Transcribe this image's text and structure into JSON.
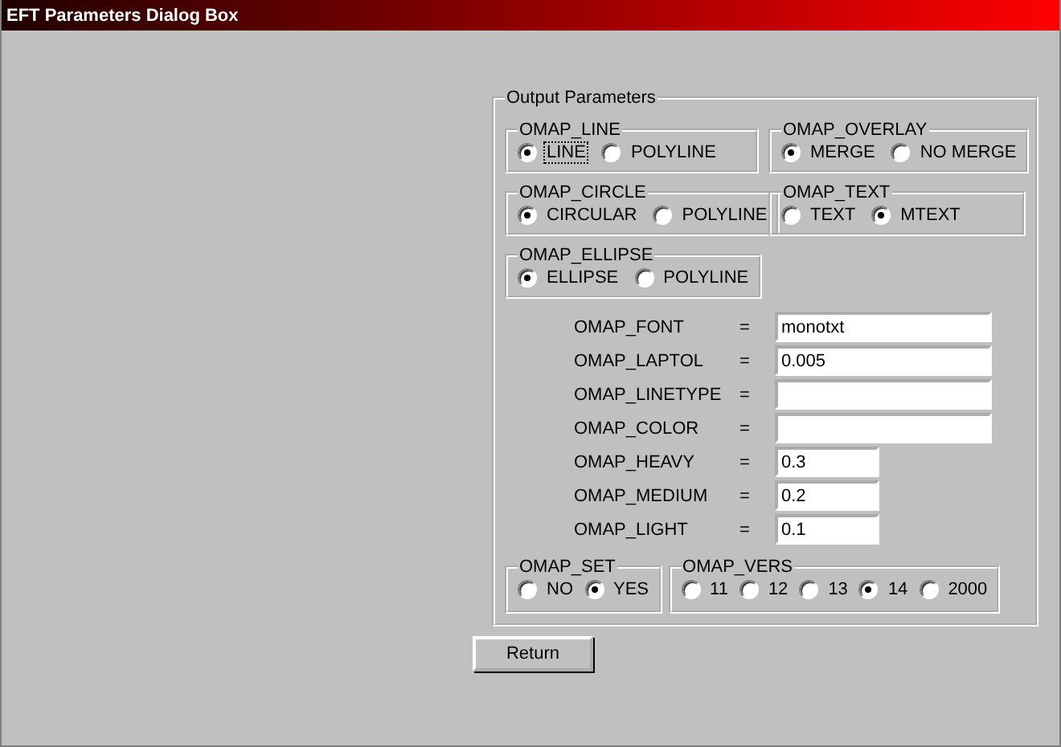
{
  "window": {
    "title": "EFT Parameters Dialog Box"
  },
  "output_parameters": {
    "title": "Output Parameters",
    "groups": [
      {
        "title": "OMAP_LINE",
        "options": [
          {
            "label": "LINE",
            "selected": true,
            "focused": true
          },
          {
            "label": "POLYLINE",
            "selected": false,
            "focused": false
          }
        ]
      },
      {
        "title": "OMAP_OVERLAY",
        "options": [
          {
            "label": "MERGE",
            "selected": true,
            "focused": false
          },
          {
            "label": "NO MERGE",
            "selected": false,
            "focused": false
          }
        ]
      },
      {
        "title": "OMAP_CIRCLE",
        "options": [
          {
            "label": "CIRCULAR",
            "selected": true,
            "focused": false
          },
          {
            "label": "POLYLINE",
            "selected": false,
            "focused": false
          }
        ]
      },
      {
        "title": "OMAP_TEXT",
        "options": [
          {
            "label": "TEXT",
            "selected": false,
            "focused": false
          },
          {
            "label": "MTEXT",
            "selected": true,
            "focused": false
          }
        ]
      },
      {
        "title": "OMAP_ELLIPSE",
        "options": [
          {
            "label": "ELLIPSE",
            "selected": true,
            "focused": false
          },
          {
            "label": "POLYLINE",
            "selected": false,
            "focused": false
          }
        ]
      }
    ],
    "fields": [
      {
        "label": "OMAP_FONT",
        "equals": "=",
        "value": "monotxt",
        "kind": "long"
      },
      {
        "label": "OMAP_LAPTOL",
        "equals": "=",
        "value": "0.005",
        "kind": "long"
      },
      {
        "label": "OMAP_LINETYPE",
        "equals": "=",
        "kind": "long"
      },
      {
        "label": "OMAP_COLOR",
        "equals": "=",
        "kind": "long"
      },
      {
        "label": "OMAP_HEAVY",
        "equals": "=",
        "value": "0.3",
        "kind": "short"
      },
      {
        "label": "OMAP_MEDIUM",
        "equals": "=",
        "value": "0.2",
        "kind": "short"
      },
      {
        "label": "OMAP_LIGHT",
        "equals": "=",
        "value": "0.1",
        "kind": "short"
      }
    ],
    "bottom_groups": [
      {
        "title": "OMAP_SET",
        "options": [
          {
            "label": "NO",
            "selected": false,
            "focused": false
          },
          {
            "label": "YES",
            "selected": true,
            "focused": false
          }
        ]
      },
      {
        "title": "OMAP_VERS",
        "options": [
          {
            "label": "11",
            "selected": false,
            "focused": false
          },
          {
            "label": "12",
            "selected": false,
            "focused": false
          },
          {
            "label": "13",
            "selected": false,
            "focused": false
          },
          {
            "label": "14",
            "selected": true,
            "focused": false
          },
          {
            "label": "2000",
            "selected": false,
            "focused": false
          }
        ]
      }
    ]
  },
  "buttons": [
    {
      "label": "Return"
    }
  ]
}
